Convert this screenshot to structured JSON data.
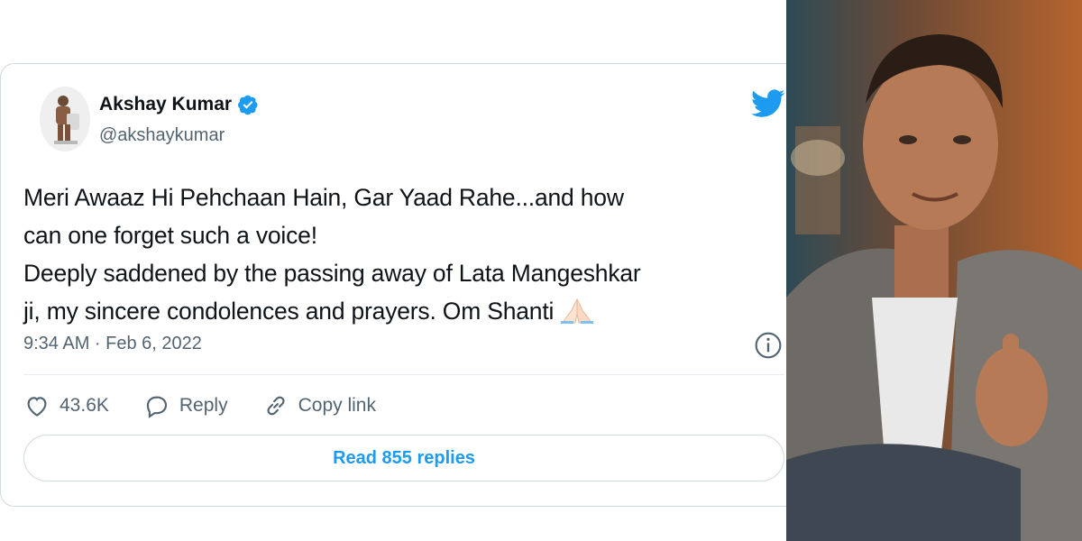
{
  "tweet": {
    "display_name": "Akshay Kumar",
    "handle": "@akshaykumar",
    "text_lines": [
      "Meri Awaaz Hi Pehchaan Hain, Gar Yaad Rahe...and how",
      "can one forget such a voice!",
      "Deeply saddened by the passing away of Lata Mangeshkar",
      "ji, my sincere condolences and prayers. Om Shanti"
    ],
    "timestamp": "9:34 AM · Feb 6, 2022",
    "like_count": "43.6K",
    "reply_label": "Reply",
    "copy_link_label": "Copy link",
    "read_replies_label": "Read 855 replies"
  },
  "icons": {
    "verified": "verified-badge-icon",
    "brand": "twitter-bird-icon",
    "info": "info-icon",
    "like": "heart-icon",
    "reply": "reply-bubble-icon",
    "copy_link": "link-icon",
    "emoji": "folded-hands-emoji"
  },
  "colors": {
    "accent": "#1d9bf0",
    "text_primary": "#0f1419",
    "text_secondary": "#536471",
    "border": "#cfd9de"
  }
}
